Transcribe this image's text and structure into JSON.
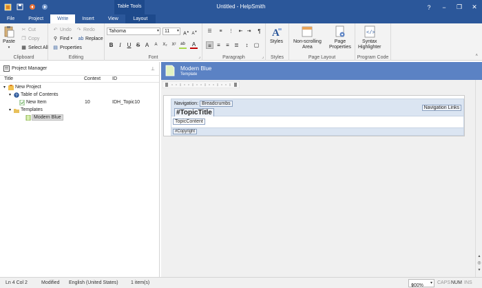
{
  "window": {
    "title": "Untitled - HelpSmith",
    "context_group": "Table Tools",
    "controls": {
      "help": "?",
      "minimize": "−",
      "restore": "❐",
      "close": "✕"
    }
  },
  "quick_access": {
    "icons": [
      "app-icon",
      "save-icon",
      "undo-icon",
      "redo-icon"
    ]
  },
  "tabs": [
    {
      "label": "File"
    },
    {
      "label": "Project"
    },
    {
      "label": "Write",
      "active": true
    },
    {
      "label": "Insert"
    },
    {
      "label": "View"
    },
    {
      "label": "Layout",
      "context": true
    }
  ],
  "ribbon": {
    "clipboard": {
      "label": "Clipboard",
      "paste": "Paste",
      "cut": "Cut",
      "copy": "Copy",
      "select_all": "Select All"
    },
    "editing": {
      "label": "Editing",
      "undo": "Undo",
      "redo": "Redo",
      "find": "Find",
      "replace": "Replace",
      "properties": "Properties"
    },
    "font": {
      "label": "Font",
      "font_name": "Tahoma",
      "font_size": "11",
      "buttons": [
        "B",
        "I",
        "U",
        "S",
        "A",
        "A",
        "X₂",
        "X²",
        "ab",
        "A"
      ]
    },
    "paragraph": {
      "label": "Paragraph"
    },
    "styles": {
      "label": "Styles",
      "button": "Styles"
    },
    "page_layout": {
      "label": "Page Layout",
      "non_scrolling": "Non-scrolling\nArea",
      "page_properties": "Page\nProperties"
    },
    "program_code": {
      "label": "Program Code",
      "syntax": "Syntax\nHighlighter"
    }
  },
  "project_manager": {
    "title": "Project Manager",
    "columns": {
      "title": "Title",
      "context": "Context",
      "id": "ID"
    },
    "tree": [
      {
        "label": "New Project",
        "level": 0,
        "icon": "project-icon"
      },
      {
        "label": "Table of Contents",
        "level": 1,
        "icon": "help-book-icon"
      },
      {
        "label": "New Item",
        "level": 2,
        "icon": "topic-icon",
        "context": "10",
        "id": "IDH_Topic10"
      },
      {
        "label": "Templates",
        "level": 1,
        "icon": "folder-icon"
      },
      {
        "label": "Modern Blue",
        "level": 2,
        "icon": "template-icon",
        "selected": true
      }
    ]
  },
  "editor": {
    "doc_title": "Modern Blue",
    "doc_subtitle": "Template",
    "template": {
      "navigation_label": "Navigation:",
      "breadcrumbs": "Breadcrumbs",
      "topic_title": "#TopicTitle",
      "navigation_links": "Navigation Links",
      "topic_content": "TopicContent",
      "copyright": "#Copyright"
    }
  },
  "status": {
    "position": "Ln 4 Col 2",
    "state": "Modified",
    "language": "English (United States)",
    "selection": "1 item(s)",
    "zoom": "100%",
    "caps": "CAPS",
    "num": "NUM",
    "ins": "INS"
  },
  "colors": {
    "title_bar": "#2b579a",
    "doc_header": "#5b82c4",
    "template_band": "#dbe5f2"
  }
}
